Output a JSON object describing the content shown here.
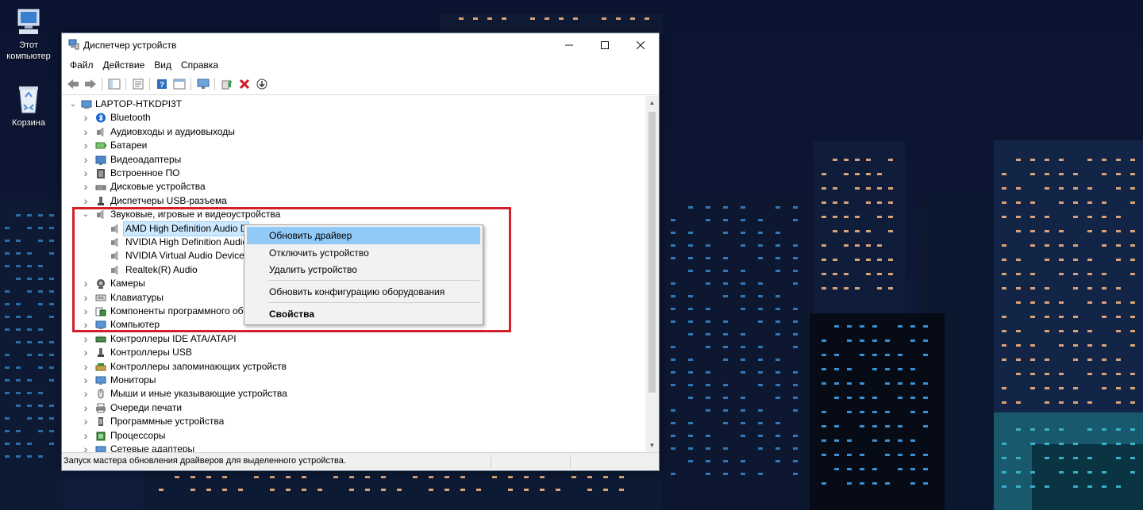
{
  "desktop": {
    "icons": [
      {
        "label_line1": "Этот",
        "label_line2": "компьютер"
      },
      {
        "label_line1": "Корзина",
        "label_line2": ""
      }
    ]
  },
  "window": {
    "title": "Диспетчер устройств",
    "controls": {
      "minimize": "—",
      "maximize": "☐",
      "close": "✕"
    },
    "menu": [
      "Файл",
      "Действие",
      "Вид",
      "Справка"
    ],
    "toolbar_icons": [
      "back-arrow-icon",
      "forward-arrow-icon",
      "show-hide-tree-icon",
      "properties-icon",
      "help-icon",
      "view-resources-icon",
      "monitor-icon",
      "update-driver-icon",
      "uninstall-icon",
      "download-icon"
    ],
    "tree": {
      "root": "LAPTOP-HTKDPI3T",
      "categories": [
        {
          "label": "Bluetooth",
          "icon": "bluetooth-icon",
          "expanded": false
        },
        {
          "label": "Аудиовходы и аудиовыходы",
          "icon": "speaker-icon",
          "expanded": false
        },
        {
          "label": "Батареи",
          "icon": "battery-icon",
          "expanded": false
        },
        {
          "label": "Видеоадаптеры",
          "icon": "display-adapter-icon",
          "expanded": false
        },
        {
          "label": "Встроенное ПО",
          "icon": "firmware-icon",
          "expanded": false
        },
        {
          "label": "Дисковые устройства",
          "icon": "disk-icon",
          "expanded": false
        },
        {
          "label": "Диспетчеры USB-разъема",
          "icon": "usb-icon",
          "expanded": false
        },
        {
          "label": "Звуковые, игровые и видеоустройства",
          "icon": "speaker-icon",
          "expanded": true,
          "children": [
            {
              "label": "AMD High Definition Audio D",
              "selected": true
            },
            {
              "label": "NVIDIA High Definition Audic",
              "selected": false
            },
            {
              "label": "NVIDIA Virtual Audio Device (",
              "selected": false
            },
            {
              "label": "Realtek(R) Audio",
              "selected": false
            }
          ]
        },
        {
          "label": "Камеры",
          "icon": "camera-icon",
          "expanded": false
        },
        {
          "label": "Клавиатуры",
          "icon": "keyboard-icon",
          "expanded": false
        },
        {
          "label": "Компоненты программного об",
          "icon": "software-component-icon",
          "expanded": false
        },
        {
          "label": "Компьютер",
          "icon": "computer-icon",
          "expanded": false
        },
        {
          "label": "Контроллеры IDE ATA/ATAPI",
          "icon": "ide-controller-icon",
          "expanded": false
        },
        {
          "label": "Контроллеры USB",
          "icon": "usb-icon",
          "expanded": false
        },
        {
          "label": "Контроллеры запоминающих устройств",
          "icon": "storage-controller-icon",
          "expanded": false
        },
        {
          "label": "Мониторы",
          "icon": "monitor-icon",
          "expanded": false
        },
        {
          "label": "Мыши и иные указывающие устройства",
          "icon": "mouse-icon",
          "expanded": false
        },
        {
          "label": "Очереди печати",
          "icon": "printer-icon",
          "expanded": false
        },
        {
          "label": "Программные устройства",
          "icon": "software-device-icon",
          "expanded": false
        },
        {
          "label": "Процессоры",
          "icon": "processor-icon",
          "expanded": false
        },
        {
          "label": "Сетевые адаптеры",
          "icon": "network-adapter-icon",
          "expanded": false
        }
      ]
    },
    "status_text": "Запуск мастера обновления драйверов для выделенного устройства."
  },
  "context_menu": {
    "items": [
      {
        "label": "Обновить драйвер",
        "hover": true
      },
      {
        "label": "Отключить устройство",
        "hover": false
      },
      {
        "label": "Удалить устройство",
        "hover": false
      },
      {
        "label": "Обновить конфигурацию оборудования",
        "hover": false
      },
      {
        "label": "Свойства",
        "hover": false,
        "bold": true
      }
    ]
  },
  "colors": {
    "highlight_border": "#d3202a",
    "menu_hover": "#91c9f7",
    "selection": "#cce8ff"
  }
}
